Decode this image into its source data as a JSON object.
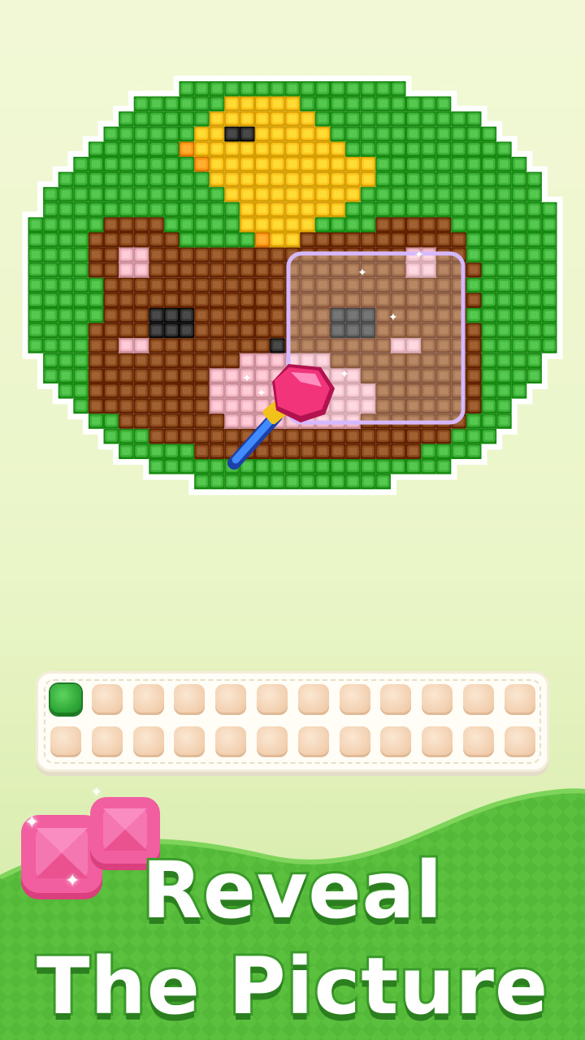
{
  "board": {
    "legend": {
      "G": "#3fb23a",
      "B": "#8a4a1c",
      "P": "#f2b6c2",
      "Y": "#ffc61f",
      "O": "#ff9a1a",
      "K": "#333333",
      "W": "#ffffff"
    },
    "rows": [
      "..........GGGGGGGGGGGGGGG..........",
      ".......GGGGGGYYYYYGGGGGGGGGG.......",
      "......GGGGGGYYYYYYYGGGGGGGGGGG.....",
      ".....GGGGGGYYKKYYYYYGGGGGGGGGGG....",
      "....GGGGGGOYYYYYYYYYYGGGGGGGGGGG...",
      "...GGGGGGGGOYYYYYYYYYYYGGGGGGGGGG..",
      "..GGGGGGGGGGYYYYYYYYYYYGGGGGGGGGGG.",
      ".GGGGGGGGGGGGYYYYYYYYYGGGGGGGGGGGG.",
      ".GGGGGGGGGGGGGYYYYYYYGGGGGGGGGGGGGG",
      "GGGGGBBBBGGGGGYYYYYGGGGBBBBBGGGGGGG",
      "GGGGBBBBBBGGGGGOYYBBBBBBBBBBBGGGGGG",
      "GGGGBBPPBBBBBBBBBBBBBBBBBPPBBGGGGGG",
      "GGGGBBPPBBBBBBBBBBBBBBBBBPPBBBGGGGG",
      "GGGGGBBBBBBBBBBBBBBBBBBBBBBBBGGGGGG",
      "GGGGGBBBBBBBBBBBBBBBBBBBBBBBBBGGGGG",
      "GGGGGBBBKKKBBBBBBBBBKKKBBBBBBGGGGGG",
      "GGGGBBBBKKKBBBBBBBBBKKKBBBBBBBGGGGG",
      "GGGGBBPPBBBBBBBBKBBBBBBBPPBBBBGGGGG",
      ".GGGBBBBBBBBBBPPPPPPBBBBBBBBBBGGGG.",
      ".GGGBBBBBBBBPPPPPPPPPPBBBBBBBBGGGG.",
      "..GGBBBBBBBBPPPPPPPPPPPBBBBBBBGGG..",
      "...GBBBBBBBBPPPPPPPPPPPBBBBBBBGG...",
      "....GGBBBBBBBPPPPPPPPPBBBBBBBGGG...",
      ".....GGGBBBBBBBBBBBBBBBBBBBBGGG....",
      "......GGGGGBBBBBBBBBBBBBBBGGGG.....",
      "........GGGGGGGGGGGGGGGGGGGG.......",
      "...........GGGGGGGGGGGGG..........."
    ]
  },
  "tray": {
    "slots_total": 24,
    "slots_filled": 1,
    "fill_color": "#2fa838"
  },
  "headline": {
    "line1": "Reveal",
    "line2": "The Picture"
  },
  "icons": {
    "magnifier": "reveal-wand-icon",
    "gems": "pink-gem-icon"
  }
}
